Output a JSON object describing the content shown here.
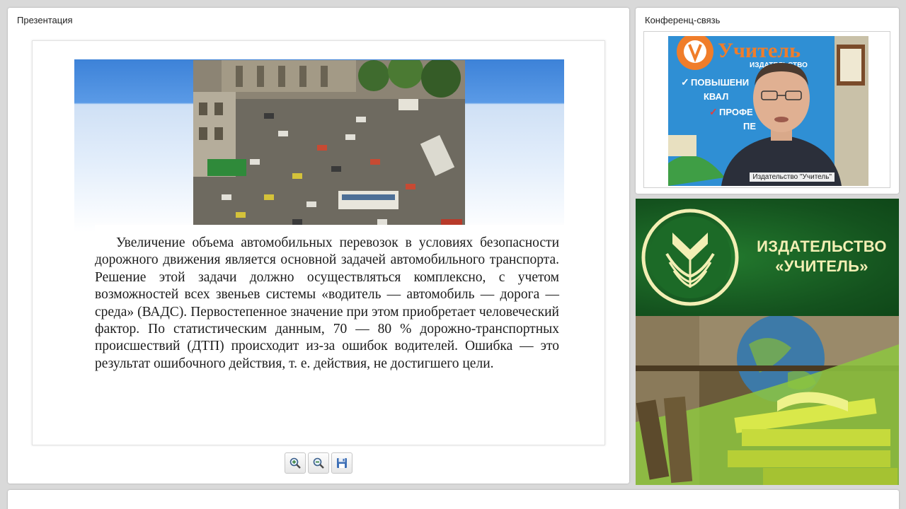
{
  "presentation": {
    "title": "Презентация",
    "slide_text": "Увеличение объема автомобильных перевозок в условиях безопасности дорожного движения является основной задачей автомобильного транспорта. Решение этой задачи должно осуществляться комплексно, с учетом возможностей всех звеньев системы «водитель — автомобиль — дорога — среда» (ВАДС). Первостепенное значение при этом приобретает человеческий фактор. По статистическим данным, 70 — 80 % дорожно-транспортных происшествий (ДТП) происходит из-за ошибок водителей. Ошибка — это результат ошибочного действия, т. е. действия, не достигшего цели.",
    "toolbar": [
      {
        "name": "zoom-in",
        "icon": "zoom-in-icon"
      },
      {
        "name": "zoom-out",
        "icon": "zoom-out-icon"
      },
      {
        "name": "save",
        "icon": "save-icon"
      }
    ]
  },
  "conference": {
    "title": "Конференц-связь",
    "speaker_name": "Издательство \"Учитель\"",
    "banner_title": "Учитель",
    "banner_subtitle": "ИЗДАТЕЛЬСТВО",
    "banner_line1": "ПОВЫШЕНИ",
    "banner_line2": "КВАЛ",
    "banner_line3": "ПРОФЕ",
    "banner_line4": "ПЕ"
  },
  "brand": {
    "line1": "ИЗДАТЕЛЬСТВО",
    "line2": "«УЧИТЕЛЬ»",
    "colors": {
      "green": "#14521e",
      "cream": "#f3efb4",
      "accent": "#8dc63f"
    }
  }
}
